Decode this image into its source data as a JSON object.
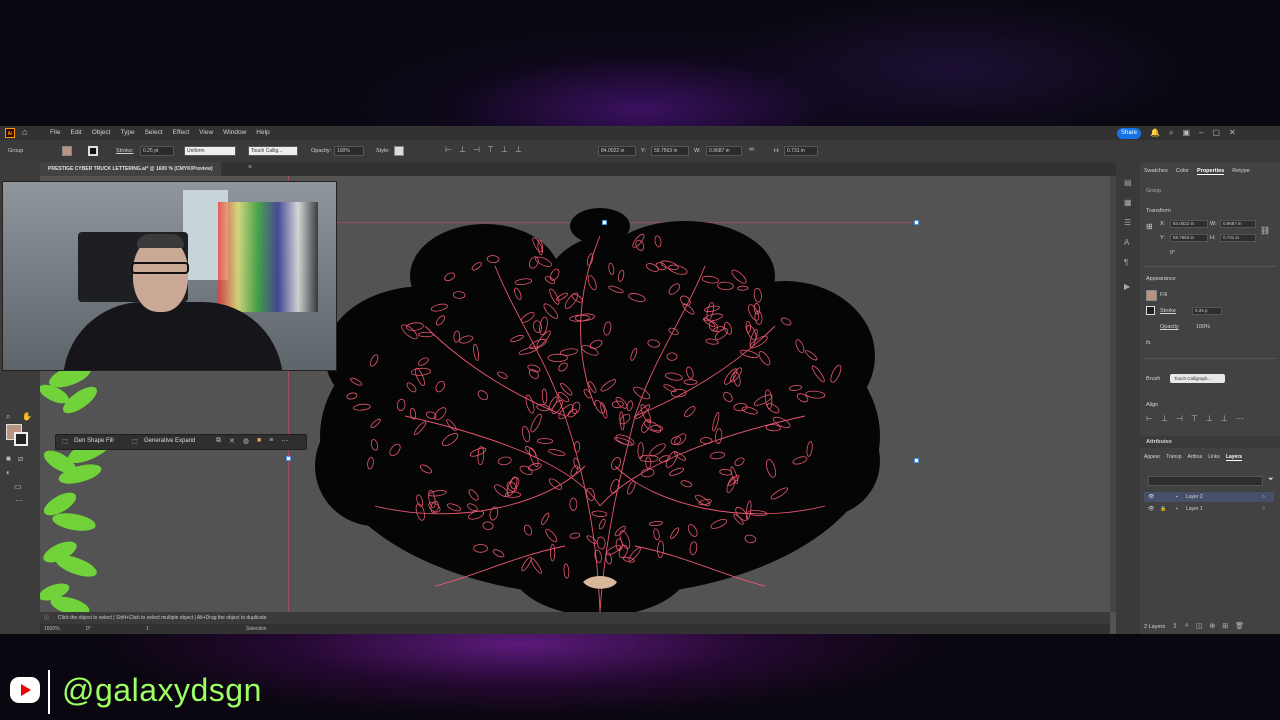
{
  "menubar": {
    "items": [
      "File",
      "Edit",
      "Object",
      "Type",
      "Select",
      "Effect",
      "View",
      "Window",
      "Help"
    ],
    "share_label": "Share",
    "app_icon": "Ai"
  },
  "control": {
    "group_label": "Group",
    "stroke_label": "Stroke:",
    "stroke_weight": "0.25 pt",
    "profile": "Uniform",
    "brush": "Touch Callig...",
    "opacity_label": "Opacity:",
    "opacity_value": "100%",
    "style_label": "Style:",
    "x_value": "84.0022 in",
    "y_label": "Y:",
    "y_value": "59.7563 in",
    "w_label": "W:",
    "w_value": "0.9687 in",
    "h_label": "H:",
    "h_value": "0.731 in"
  },
  "document": {
    "tab_title": "PRESTIGE CYBER TRUCK LETTERING.ai* @ 1600 % (CMYK/Preview)"
  },
  "context_bar": {
    "gen_shape_fill": "Gen Shape Fill",
    "generative_expand": "Generative Expand"
  },
  "status": {
    "hint": "Click the object to select  |  Shift+Click to select multiple object  |  Alt+Drag the object to duplicate",
    "zoom": "1600%",
    "rotation": "0°",
    "artboard": "1",
    "tool": "Selection"
  },
  "panel": {
    "tabs": [
      "Swatches",
      "Color",
      "Properties",
      "Retype"
    ],
    "active_tab": "Properties",
    "group_label": "Group",
    "transform_label": "Transform",
    "x_label": "X:",
    "x_value": "84.0022 in",
    "y_label": "Y:",
    "y_value": "59.7563 in",
    "w_label": "W:",
    "w_value": "0.9687 in",
    "h_label": "H:",
    "h_value": "0.731 in",
    "rotation": "0°",
    "appearance_label": "Appearance",
    "fill_label": "Fill",
    "stroke_label": "Stroke",
    "stroke_value": "0.25 p",
    "opacity_label": "Opacity",
    "opacity_value": "100%",
    "fx_label": "fx.",
    "brush_label": "Brush",
    "brush_value": "Touch Calligraph...",
    "align_label": "Align",
    "attributes_label": "Attributes",
    "lower_tabs": [
      "Appear",
      "Transp",
      "Artboa",
      "Links",
      "Layers"
    ],
    "lower_active": "Layers",
    "layers": [
      {
        "name": "Layer 2",
        "selected": true
      },
      {
        "name": "Layer 1",
        "selected": false
      }
    ],
    "layers_count": "2 Layers"
  },
  "colors": {
    "fill_swatch": "#b89580",
    "accent": "#1473e6",
    "outline": "#e8576e",
    "leaf_green": "#72d23a",
    "handle_green": "#9dff63"
  },
  "overlay": {
    "handle": "@galaxydsgn"
  }
}
